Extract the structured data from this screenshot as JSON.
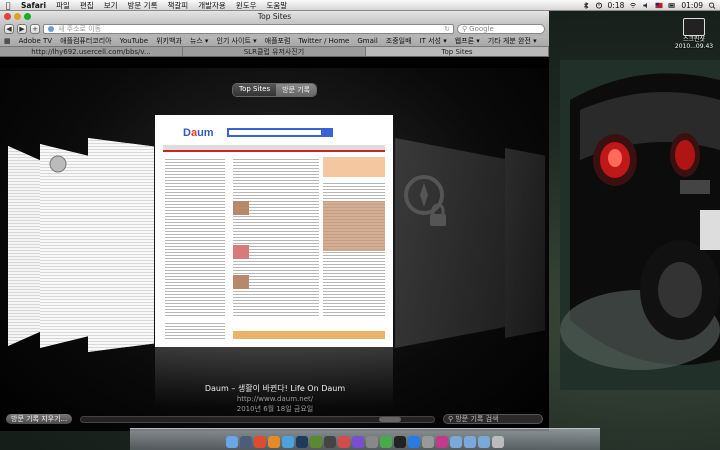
{
  "menubar": {
    "app": "Safari",
    "items": [
      "파일",
      "편집",
      "보기",
      "방문 기록",
      "책갈피",
      "개발자용",
      "윈도우",
      "도움말"
    ],
    "time": "01:09",
    "time_indicator": "0:18",
    "icons": [
      "apple-icon",
      "bluetooth-icon",
      "timer-icon",
      "wifi-icon",
      "volume-icon",
      "flag-icon",
      "battery-icon",
      "spotlight-icon"
    ]
  },
  "desktop": {
    "icon_label_1": "스크린샷",
    "icon_label_2": "2010...09.43"
  },
  "window": {
    "title": "Top Sites",
    "address_placeholder": "새 주소로 이동",
    "search_placeholder": "Google",
    "bookmarks": [
      "Adobe TV",
      "애플컴퓨터코리아",
      "YouTube",
      "위키백과",
      "뉴스 ▾",
      "인기 사이트 ▾",
      "애플포럼",
      "Twitter / Home",
      "Gmail",
      "조중일배",
      "IT 서성 ▾",
      "웹프론 ▾",
      "기타 게분 완전 ▾"
    ],
    "tabs": [
      {
        "label": "http://lhy692.usercell.com/bbs/v...",
        "active": false
      },
      {
        "label": "SLR클럽 유저사진기",
        "active": false
      },
      {
        "label": "Top Sites",
        "active": true
      }
    ]
  },
  "topsites": {
    "segments": [
      "Top Sites",
      "방문 기록"
    ],
    "active_segment": "Top Sites",
    "site_title": "Daum – 생활이 바뀐다! Life On Daum",
    "site_url": "http://www.daum.net/",
    "site_date": "2010년 6월 18일 금요일",
    "clear_history": "방문 기록 지우기...",
    "history_search_placeholder": "방문 기록 검색",
    "scroll_position": 0.9
  },
  "dock": {
    "icons": [
      "finder-icon",
      "dashboard-icon",
      "chrome-icon",
      "firefox-icon",
      "safari-icon",
      "photoshop-icon",
      "dreamweaver-icon",
      "app-icon",
      "ical-icon",
      "itunes-icon",
      "settings-icon",
      "mail-icon",
      "terminal-icon",
      "app-store-icon",
      "preview-icon",
      "music-icon",
      "folder-icon",
      "folder-icon",
      "folder-icon",
      "trash-icon"
    ],
    "colors": [
      "#6aa5e8",
      "#4b5d7a",
      "#e04a2f",
      "#e48a2a",
      "#4aa3df",
      "#1e3a5c",
      "#5b8a2e",
      "#444444",
      "#d44b4b",
      "#7a4fcf",
      "#888888",
      "#4aa94a",
      "#222222",
      "#2a7ae2",
      "#999999",
      "#c43a8b",
      "#7aa8d8",
      "#7aa8d8",
      "#7aa8d8",
      "#bbbbbb"
    ]
  }
}
